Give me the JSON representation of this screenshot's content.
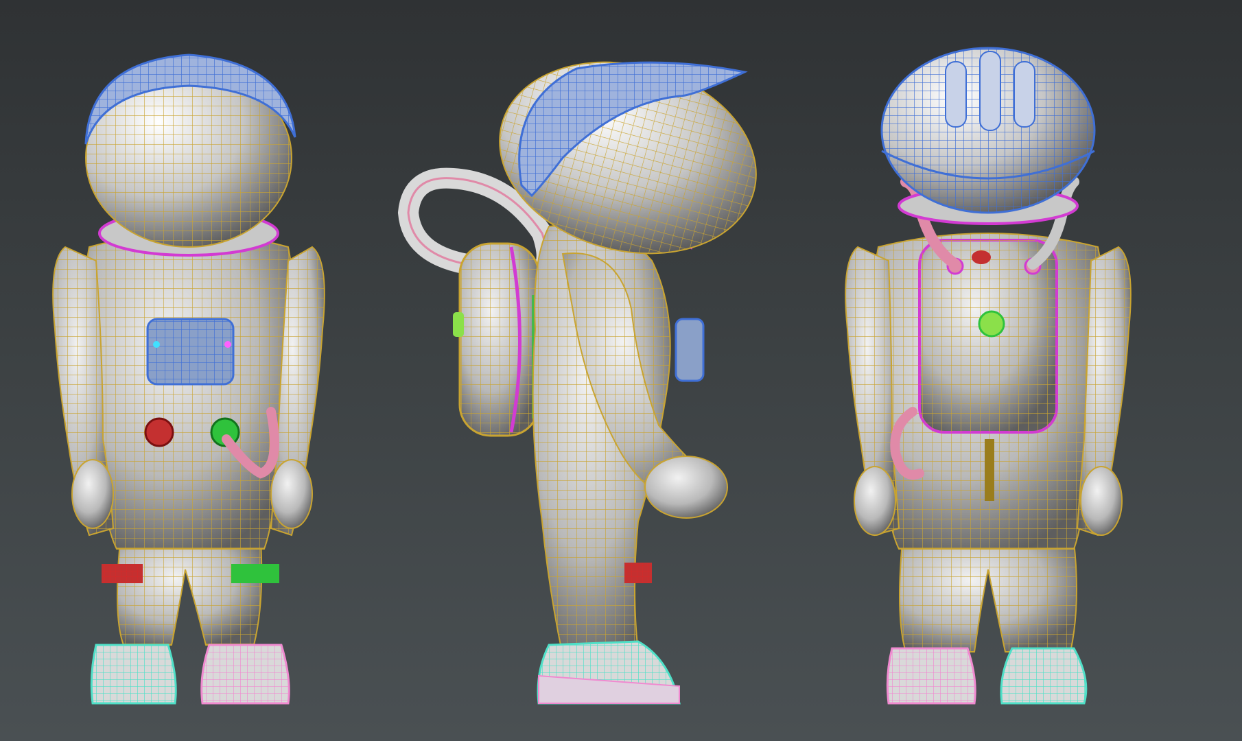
{
  "viewport": {
    "background_top": "#2f3234",
    "background_bottom": "#4a5053"
  },
  "wireframe_colors": {
    "body": "#c9a431",
    "helmet": "#3f6fd6",
    "collar": "#d23bd2",
    "chest_panel": "#3f6fd6",
    "left_knee_patch": "#d22a2a",
    "right_knee_patch": "#2fc23c",
    "left_boot": "#4fe0c8",
    "right_boot": "#f08ad0",
    "hose": "#e08aa8",
    "shaded_surface": "#bdbdbd"
  },
  "views": [
    {
      "name": "front-view"
    },
    {
      "name": "side-view"
    },
    {
      "name": "back-view"
    }
  ]
}
